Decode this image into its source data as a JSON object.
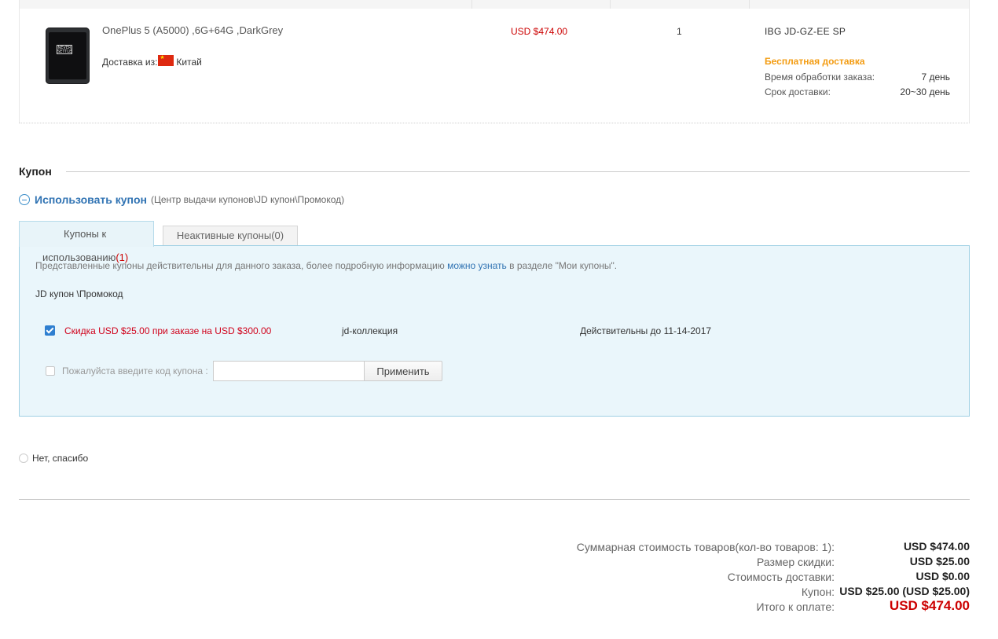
{
  "product": {
    "name": "OnePlus 5 (A5000) ,6G+64G ,DarkGrey",
    "image_icon": "phone-product-image",
    "ship_from_label": "Доставка из:",
    "ship_from_country": "Китай",
    "price": "USD $474.00",
    "quantity": "1",
    "seller": "IBG JD-GZ-EE SP",
    "shipping": {
      "free_label": "Бесплатная доставка",
      "processing_label": "Время обработки заказа:",
      "processing_value": "7 день",
      "delivery_label": "Срок доставки:",
      "delivery_value": "20~30 день"
    }
  },
  "coupon": {
    "section_title": "Купон",
    "use_title": "Использовать купон",
    "use_subtitle": "(Центр выдачи купонов\\JD купон\\Промокод)",
    "tabs": {
      "available_label_1": "Купоны к",
      "available_label_2": "использованию",
      "available_count": "(1)",
      "inactive_label": "Неактивные купоны(0)"
    },
    "notice_before": "Представленные купоны действительны для данного заказа, более подробную информацию ",
    "notice_link": "можно узнать",
    "notice_after": " в разделе \"Мои купоны\".",
    "group_label": "JD купон \\Промокод",
    "item": {
      "description": "Скидка USD $25.00 при заказе на USD $300.00",
      "type": "jd-коллекция",
      "valid": "Действительны до 11-14-2017",
      "checked": true
    },
    "code_label": "Пожалуйста введите код купона :",
    "code_value": "",
    "apply_label": "Применить",
    "no_thanks": "Нет, спасибо"
  },
  "summary": {
    "items_label": "Суммарная стоимость товаров(кол-во товаров: 1):",
    "items_value": "USD $474.00",
    "discount_label": "Размер скидки:",
    "discount_value": "USD $25.00",
    "shipping_label": "Стоимость доставки:",
    "shipping_value": "USD $0.00",
    "coupon_label": "Купон:",
    "coupon_value": "USD $25.00 (USD $25.00)",
    "total_label": "Итого к оплате:",
    "total_value": "USD $474.00"
  },
  "colors": {
    "price_red": "#cc0000",
    "link_blue": "#3073b3",
    "free_shipping_orange": "#f39c12",
    "coupon_panel_bg": "#eaf6fb"
  }
}
